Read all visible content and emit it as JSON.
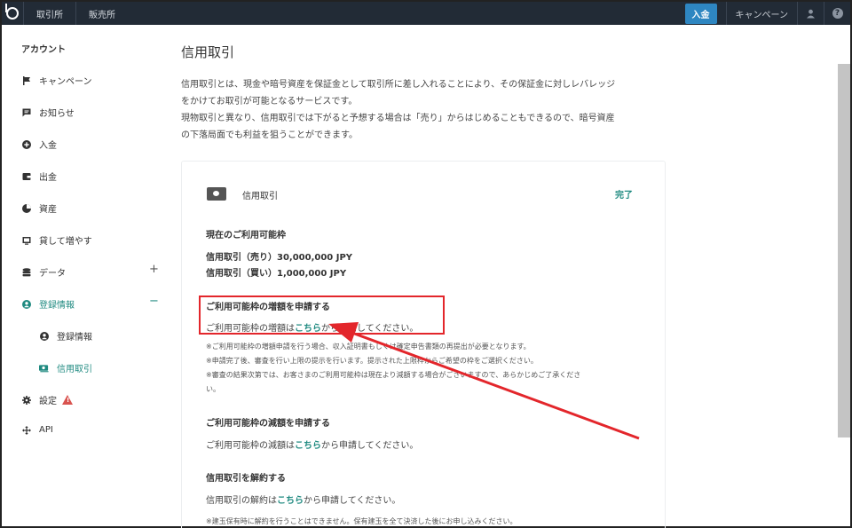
{
  "topbar": {
    "tabs": [
      "取引所",
      "販売所"
    ],
    "deposit_label": "入金",
    "campaign_label": "キャンペーン",
    "user_icon": "user-icon",
    "help_icon": "help-icon",
    "help_glyph": "?"
  },
  "sidebar": {
    "heading": "アカウント",
    "items": [
      {
        "label": "キャンペーン",
        "icon": "flag-icon"
      },
      {
        "label": "お知らせ",
        "icon": "message-icon"
      },
      {
        "label": "入金",
        "icon": "plus-circle-icon"
      },
      {
        "label": "出金",
        "icon": "wallet-icon"
      },
      {
        "label": "資産",
        "icon": "pie-chart-icon"
      },
      {
        "label": "貸して増やす",
        "icon": "lend-icon"
      },
      {
        "label": "データ",
        "icon": "database-icon",
        "toggle": "+"
      },
      {
        "label": "登録情報",
        "icon": "user-circle-icon",
        "toggle": "−"
      },
      {
        "label": "登録情報",
        "icon": "user-circle-icon"
      },
      {
        "label": "信用取引",
        "icon": "money-icon"
      },
      {
        "label": "設定",
        "icon": "gear-icon",
        "warning": "!"
      },
      {
        "label": "API",
        "icon": "api-icon"
      }
    ]
  },
  "main": {
    "title": "信用取引",
    "intro": [
      "信用取引とは、現金や暗号資産を保証金として取引所に差し入れることにより、その保証金に対しレバレッジ",
      "をかけてお取引が可能となるサービスです。",
      "現物取引と異なり、信用取引では下がると予想する場合は「売り」からはじめることもできるので、暗号資産",
      "の下落局面でも利益を狙うことができます。"
    ],
    "card": {
      "name": "信用取引",
      "status": "完了",
      "limit_heading": "現在のご利用可能枠",
      "limit_sell": "信用取引（売り）30,000,000 JPY",
      "limit_buy": "信用取引（買い）1,000,000 JPY",
      "increase_heading": "ご利用可能枠の増額を申請する",
      "increase_pre": "ご利用可能枠の増額は",
      "link_text": "こちら",
      "increase_post": "から申請してください。",
      "increase_notes": [
        "※ご利用可能枠の増額申請を行う場合、収入証明書もしくは確定申告書類の再提出が必要となります。",
        "※申請完了後、審査を行い上限の提示を行います。提示された上限枠からご希望の枠をご選択ください。",
        "※審査の結果次第では、お客さまのご利用可能枠は現在より減額する場合がございますので、あらかじめご了承くださ",
        "い。"
      ],
      "decrease_heading": "ご利用可能枠の減額を申請する",
      "decrease_pre": "ご利用可能枠の減額は",
      "decrease_post": "から申請してください。",
      "cancel_heading": "信用取引を解約する",
      "cancel_pre": "信用取引の解約は",
      "cancel_post": "から申請してください。",
      "cancel_note": "※建玉保有時に解約を行うことはできません。保有建玉を全て決済した後にお申し込みください。"
    }
  },
  "annotation": {
    "color": "#e3262b"
  }
}
